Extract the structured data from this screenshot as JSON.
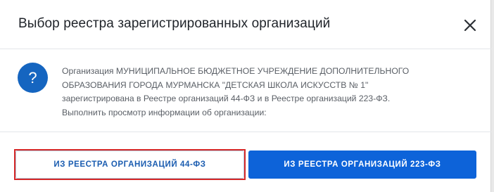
{
  "dialog": {
    "title": "Выбор реестра зарегистрированных организаций",
    "close_icon": "close-icon"
  },
  "message": {
    "icon": "question-icon",
    "icon_glyph": "?",
    "lines": [
      "Организация МУНИЦИПАЛЬНОЕ БЮДЖЕТНОЕ УЧРЕЖДЕНИЕ ДОПОЛНИТЕЛЬНОГО",
      "ОБРАЗОВАНИЯ ГОРОДА МУРМАНСКА \"ДЕТСКАЯ ШКОЛА ИСКУССТВ № 1\"",
      "зарегистрирована в Реестре организаций 44-ФЗ и в Реестре организаций 223-ФЗ.",
      "Выполнить просмотр информации об организации:"
    ]
  },
  "buttons": {
    "registry_44": "ИЗ РЕЕСТРА ОРГАНИЗАЦИЙ 44-ФЗ",
    "registry_223": "ИЗ РЕЕСТРА ОРГАНИЗАЦИЙ 223-ФЗ"
  },
  "colors": {
    "primary": "#0d63d9",
    "icon_bg": "#1565c0",
    "highlight": "#d62828"
  }
}
